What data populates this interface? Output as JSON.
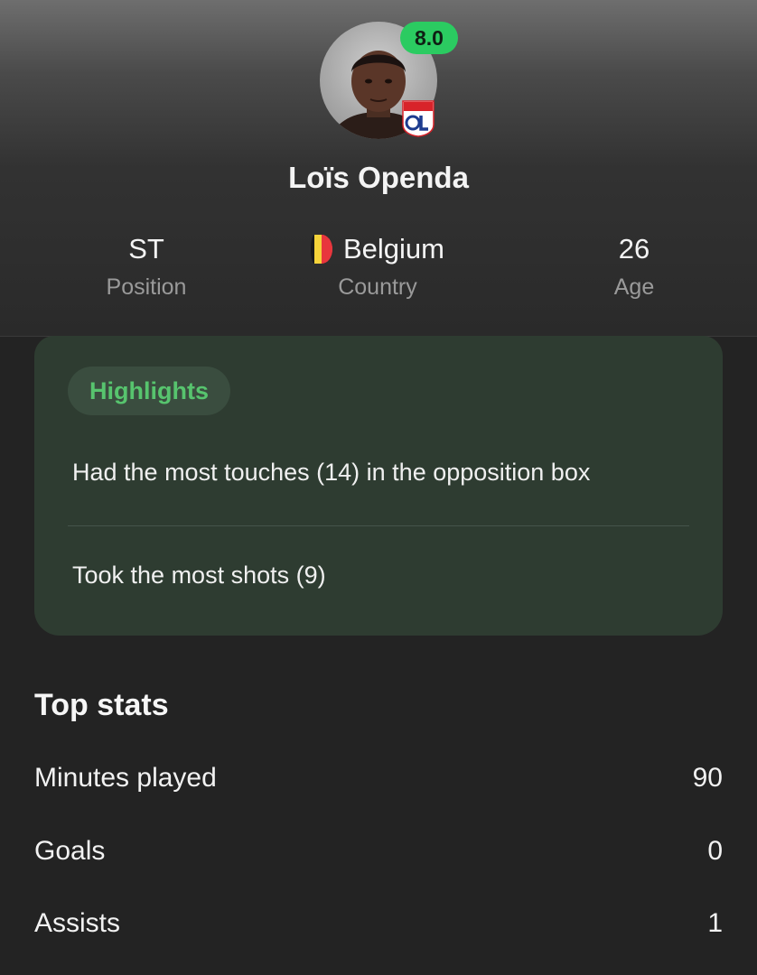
{
  "player": {
    "name": "Loïs Openda",
    "rating": "8.0",
    "club_badge_text": "OLYMPIQUE LYONNAIS"
  },
  "info": {
    "position": {
      "value": "ST",
      "label": "Position"
    },
    "country": {
      "value": "Belgium",
      "label": "Country"
    },
    "age": {
      "value": "26",
      "label": "Age"
    }
  },
  "highlights": {
    "title": "Highlights",
    "items": [
      "Had the most touches (14) in the opposition box",
      "Took the most shots (9)"
    ]
  },
  "top_stats": {
    "title": "Top stats",
    "rows": [
      {
        "label": "Minutes played",
        "value": "90"
      },
      {
        "label": "Goals",
        "value": "0"
      },
      {
        "label": "Assists",
        "value": "1"
      }
    ]
  },
  "colors": {
    "rating_badge": "#2bcb61",
    "highlight_accent": "#57c46e",
    "card_bg": "#2e3c31",
    "page_bg": "#232323"
  },
  "icons": {
    "avatar": "player-photo",
    "club": "lyon-club-badge-icon",
    "flag": "belgium-flag-icon"
  }
}
